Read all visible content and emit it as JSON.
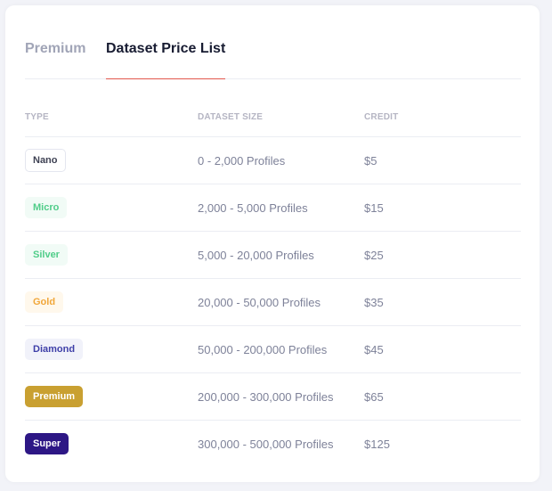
{
  "tabs": {
    "premium_label": "Premium",
    "price_list_label": "Dataset Price List"
  },
  "table": {
    "headers": {
      "type": "TYPE",
      "size": "DATASET SIZE",
      "credit": "CREDIT"
    },
    "rows": [
      {
        "type": "Nano",
        "size": "0 - 2,000 Profiles",
        "credit": "$5"
      },
      {
        "type": "Micro",
        "size": "2,000 - 5,000 Profiles",
        "credit": "$15"
      },
      {
        "type": "Silver",
        "size": "5,000 - 20,000 Profiles",
        "credit": "$25"
      },
      {
        "type": "Gold",
        "size": "20,000 - 50,000 Profiles",
        "credit": "$35"
      },
      {
        "type": "Diamond",
        "size": "50,000 - 200,000 Profiles",
        "credit": "$45"
      },
      {
        "type": "Premium",
        "size": "200,000 - 300,000 Profiles",
        "credit": "$65"
      },
      {
        "type": "Super",
        "size": "300,000 - 500,000 Profiles",
        "credit": "$125"
      }
    ]
  },
  "colors": {
    "active_tab_underline": "#e2574c",
    "premium_badge": "#c9a031",
    "super_badge": "#2d1785"
  }
}
